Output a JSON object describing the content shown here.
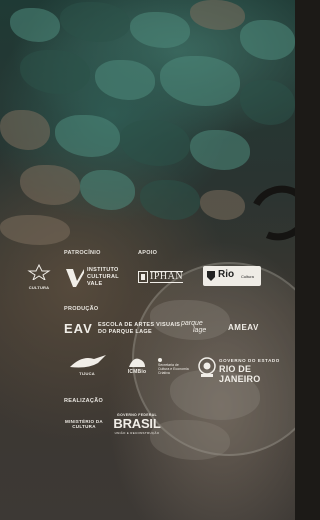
{
  "sections": {
    "patrocinio": "PATROCÍNIO",
    "apoio": "APOIO",
    "producao": "PRODUÇÃO",
    "realizacao": "REALIZAÇÃO"
  },
  "logos": {
    "cultura": {
      "name": "secretaria-cultura-logo",
      "text": "CULTURA"
    },
    "instituto_vale": {
      "line1": "INSTITUTO",
      "line2": "CULTURAL",
      "line3": "VALE"
    },
    "iphan": {
      "text": "IPHAN"
    },
    "rio_cultura": {
      "main": "Rio",
      "sub": "Cultura"
    },
    "eav": {
      "mark": "EAV",
      "line1": "ESCOLA DE ARTES VISUAIS",
      "line2": "DO PARQUE LAGE"
    },
    "parque_lage": {
      "line1": "parque",
      "line2": "lage"
    },
    "ameav": {
      "text": "AMEAV"
    },
    "tijuca": {
      "text": "TIJUCA"
    },
    "icmbio": {
      "text": "ICMBio"
    },
    "sec_cultura_rj": {
      "line1": "Secretaria de",
      "line2": "Cultura e Economia",
      "line3": "Criativa"
    },
    "governo_rj": {
      "line1": "GOVERNO DO ESTADO",
      "line2": "RIO DE JANEIRO"
    },
    "ministerio": {
      "line1": "MINISTÉRIO DA",
      "line2": "CULTURA"
    },
    "brasil": {
      "top": "GOVERNO FEDERAL",
      "main": "BRASIL",
      "sub": "UNIÃO E RECONSTRUÇÃO"
    }
  },
  "colors": {
    "text": "#f1eee8",
    "leaf_green": "#4f8a7c",
    "leaf_dark": "#2b5249",
    "background": "#2a3431"
  }
}
